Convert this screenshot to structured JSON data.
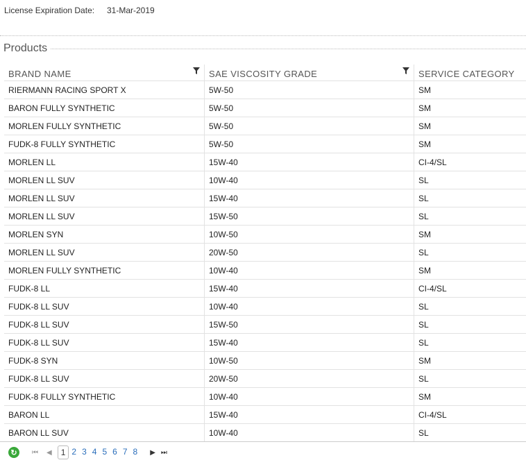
{
  "license": {
    "label": "License Expiration Date:",
    "value": "31-Mar-2019"
  },
  "products": {
    "title": "Products",
    "columns": [
      "BRAND NAME",
      "SAE VISCOSITY GRADE",
      "SERVICE CATEGORY"
    ],
    "rows": [
      [
        "RIERMANN RACING SPORT X",
        "5W-50",
        "SM"
      ],
      [
        "BARON FULLY SYNTHETIC",
        "5W-50",
        "SM"
      ],
      [
        "MORLEN FULLY SYNTHETIC",
        "5W-50",
        "SM"
      ],
      [
        "FUDK-8 FULLY SYNTHETIC",
        "5W-50",
        "SM"
      ],
      [
        "MORLEN LL",
        "15W-40",
        "CI-4/SL"
      ],
      [
        "MORLEN LL SUV",
        "10W-40",
        "SL"
      ],
      [
        "MORLEN LL SUV",
        "15W-40",
        "SL"
      ],
      [
        "MORLEN LL SUV",
        "15W-50",
        "SL"
      ],
      [
        "MORLEN SYN",
        "10W-50",
        "SM"
      ],
      [
        "MORLEN LL SUV",
        "20W-50",
        "SL"
      ],
      [
        "MORLEN FULLY SYNTHETIC",
        "10W-40",
        "SM"
      ],
      [
        "FUDK-8 LL",
        "15W-40",
        "CI-4/SL"
      ],
      [
        "FUDK-8 LL SUV",
        "10W-40",
        "SL"
      ],
      [
        "FUDK-8 LL SUV",
        "15W-50",
        "SL"
      ],
      [
        "FUDK-8 LL SUV",
        "15W-40",
        "SL"
      ],
      [
        "FUDK-8 SYN",
        "10W-50",
        "SM"
      ],
      [
        "FUDK-8 LL SUV",
        "20W-50",
        "SL"
      ],
      [
        "FUDK-8 FULLY SYNTHETIC",
        "10W-40",
        "SM"
      ],
      [
        "BARON LL",
        "15W-40",
        "CI-4/SL"
      ],
      [
        "BARON LL SUV",
        "10W-40",
        "SL"
      ]
    ]
  },
  "pager": {
    "pages": [
      "1",
      "2",
      "3",
      "4",
      "5",
      "6",
      "7",
      "8"
    ],
    "current": "1",
    "icons": {
      "refresh": "refresh-icon",
      "first": "first-page-icon",
      "prev": "prev-page-icon",
      "next": "next-page-icon",
      "last": "last-page-icon"
    }
  }
}
